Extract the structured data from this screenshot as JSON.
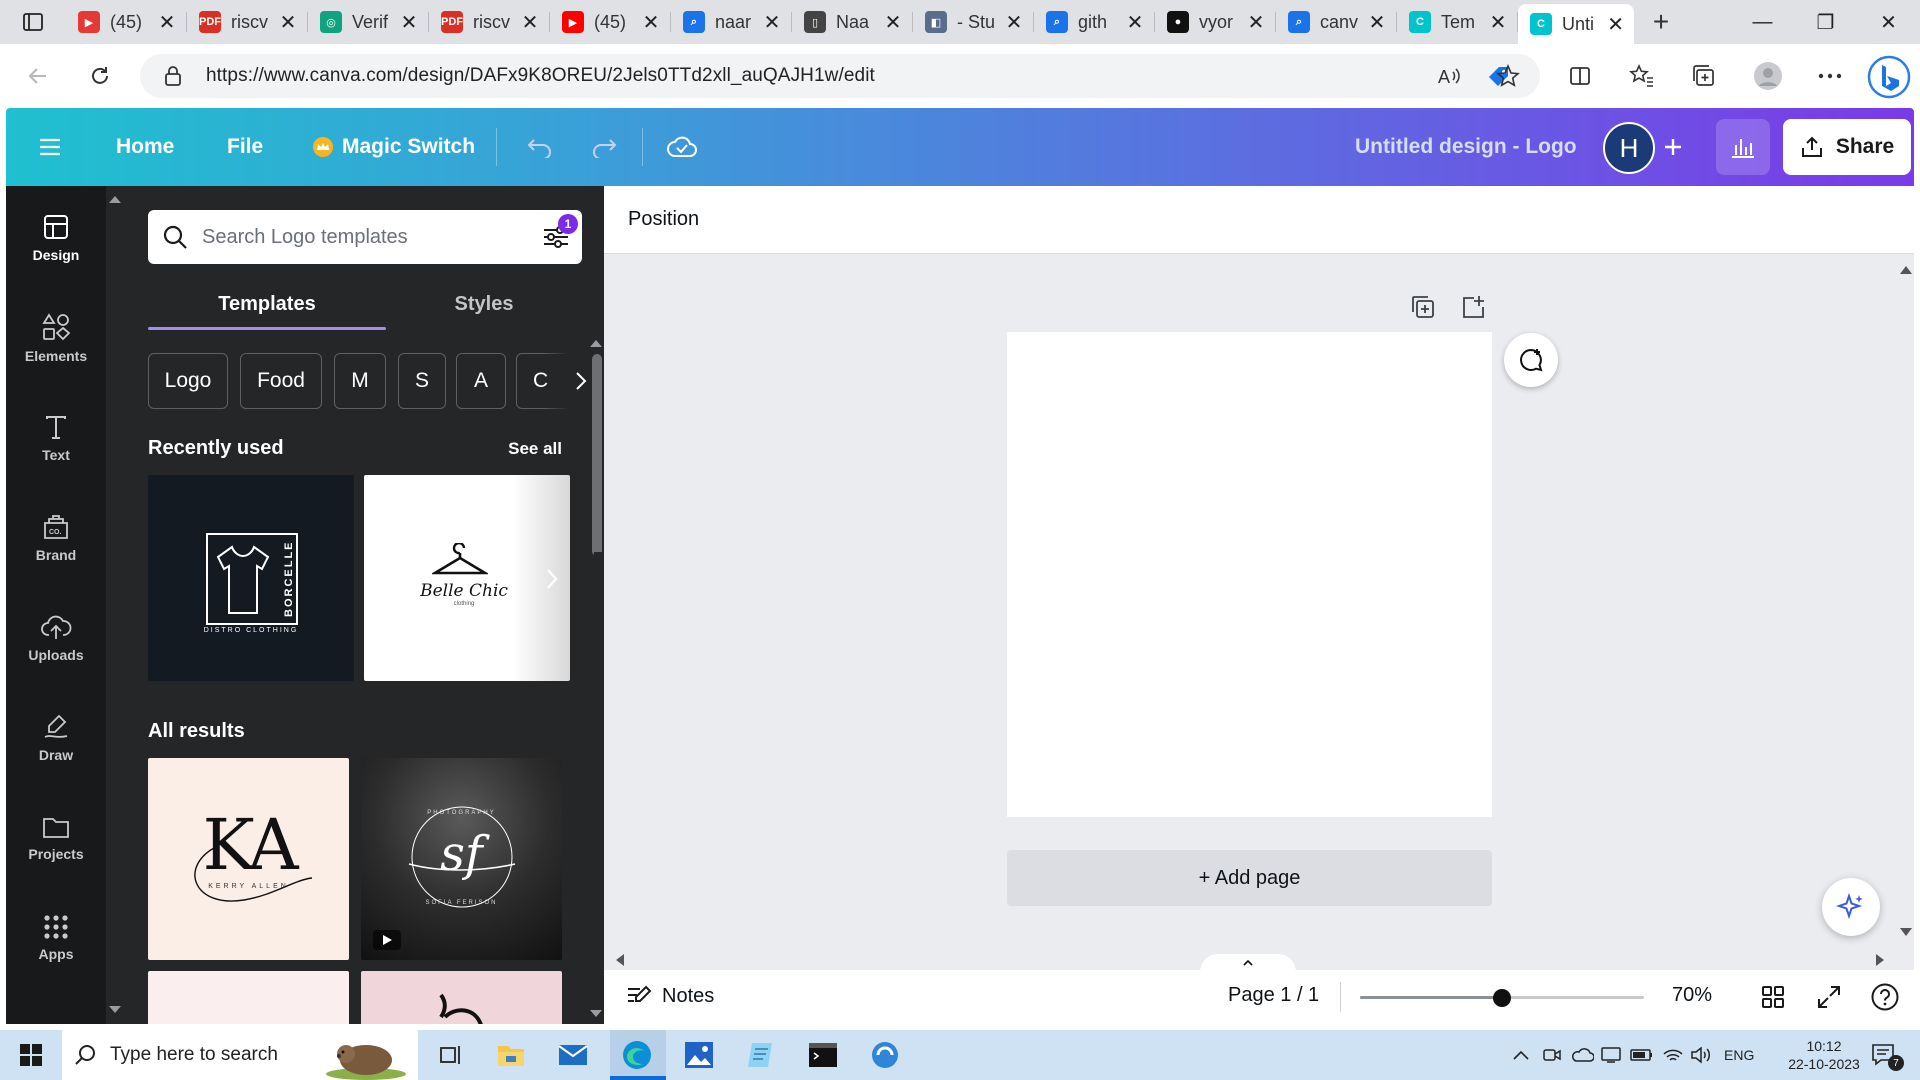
{
  "browser": {
    "tabs": [
      {
        "title": "(45)",
        "fav_color": "#e53935",
        "fav_glyph": "▶"
      },
      {
        "title": "riscv",
        "fav_color": "#d93025",
        "fav_glyph": "PDF"
      },
      {
        "title": "Verif",
        "fav_color": "#10a37f",
        "fav_glyph": "◎"
      },
      {
        "title": "riscv",
        "fav_color": "#d93025",
        "fav_glyph": "PDF"
      },
      {
        "title": "(45)",
        "fav_color": "#ff0000",
        "fav_glyph": "▶"
      },
      {
        "title": "naar",
        "fav_color": "#1a73e8",
        "fav_glyph": "⌕"
      },
      {
        "title": "Naa",
        "fav_color": "#444444",
        "fav_glyph": "▯"
      },
      {
        "title": "- Stu",
        "fav_color": "#5a6b8c",
        "fav_glyph": "◧"
      },
      {
        "title": "gith",
        "fav_color": "#1a73e8",
        "fav_glyph": "⌕"
      },
      {
        "title": "vyor",
        "fav_color": "#111111",
        "fav_glyph": "●"
      },
      {
        "title": "canv",
        "fav_color": "#1a73e8",
        "fav_glyph": "⌕"
      },
      {
        "title": "Tem",
        "fav_color": "#00c4cc",
        "fav_glyph": "C"
      },
      {
        "title": "Unti",
        "fav_color": "#00c4cc",
        "fav_glyph": "C",
        "active": true
      }
    ],
    "close_glyph": "✕",
    "new_tab_glyph": "+",
    "url": "https://www.canva.com/design/DAFx9K8OREU/2Jels0TTd2xll_auQAJH1w/edit",
    "window_controls": [
      "—",
      "❐",
      "✕"
    ]
  },
  "canva": {
    "header": {
      "home": "Home",
      "file": "File",
      "magic_switch": "Magic Switch",
      "title": "Untitled design - Logo",
      "avatar_initial": "H",
      "share": "Share"
    },
    "rail": [
      {
        "label": "Design",
        "icon": "design-icon",
        "active": true
      },
      {
        "label": "Elements",
        "icon": "elements-icon"
      },
      {
        "label": "Text",
        "icon": "text-icon"
      },
      {
        "label": "Brand",
        "icon": "brand-icon"
      },
      {
        "label": "Uploads",
        "icon": "uploads-icon"
      },
      {
        "label": "Draw",
        "icon": "draw-icon"
      },
      {
        "label": "Projects",
        "icon": "projects-icon"
      },
      {
        "label": "Apps",
        "icon": "apps-icon"
      }
    ],
    "panel": {
      "search_placeholder": "Search Logo templates",
      "filter_count": "1",
      "tabs": [
        "Templates",
        "Styles"
      ],
      "chips": [
        "Logo",
        "Food",
        "M",
        "S",
        "A",
        "C"
      ],
      "recently_used": "Recently used",
      "see_all": "See all",
      "all_results": "All results",
      "thumbs": {
        "borcelle_brand": "BORCELLE",
        "borcelle_sub": "DISTRO CLOTHING",
        "belle_brand": "Belle Chic",
        "belle_sub": "clothing",
        "ka_mono": "KA",
        "ka_sub": "KERRY ALLEN",
        "sf_mono": "sf",
        "sf_top": "PHOTOGRAPHY",
        "sf_bottom": "SOFIA FERISON"
      }
    },
    "editor": {
      "context": "Position",
      "add_page": "+ Add page",
      "notes": "Notes",
      "page_indicator": "Page 1 / 1",
      "zoom": "70%",
      "zoom_fraction": 0.5
    }
  },
  "taskbar": {
    "search_placeholder": "Type here to search",
    "lang": "ENG",
    "time": "10:12",
    "date": "22-10-2023",
    "notifications": "7"
  }
}
